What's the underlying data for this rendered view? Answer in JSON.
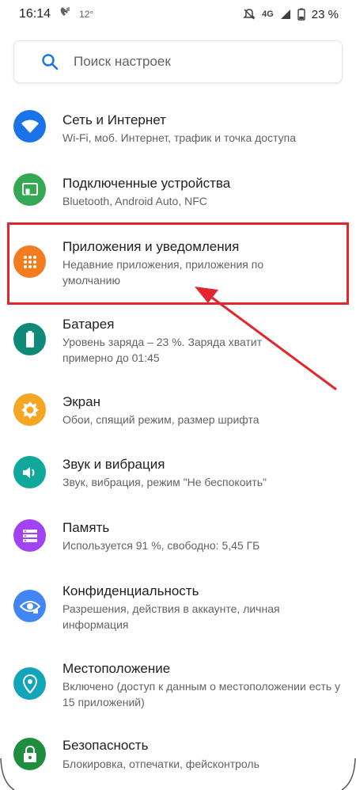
{
  "status": {
    "time": "16:14",
    "temp": "12°",
    "network": "4G",
    "battery": "23 %"
  },
  "search": {
    "placeholder": "Поиск настроек"
  },
  "items": [
    {
      "title": "Сеть и Интернет",
      "sub": "Wi-Fi, моб. Интернет, трафик и точка доступа",
      "color": "#1a73e8",
      "icon": "wifi-icon"
    },
    {
      "title": "Подключенные устройства",
      "sub": "Bluetooth, Android Auto, NFC",
      "color": "#34a853",
      "icon": "devices-icon"
    },
    {
      "title": "Приложения и уведомления",
      "sub": "Недавние приложения, приложения по умолчанию",
      "color": "#f47c20",
      "icon": "apps-icon"
    },
    {
      "title": "Батарея",
      "sub": "Уровень заряда – 23 %. Заряда хватит примерно до 01:45",
      "color": "#0f8a79",
      "icon": "battery-icon"
    },
    {
      "title": "Экран",
      "sub": "Обои, спящий режим, размер шрифта",
      "color": "#f5a623",
      "icon": "brightness-icon"
    },
    {
      "title": "Звук и вибрация",
      "sub": "Звук, вибрация, режим \"Не беспокоить\"",
      "color": "#10a89a",
      "icon": "volume-icon"
    },
    {
      "title": "Память",
      "sub": "Используется 91 %, свободно: 5,45 ГБ",
      "color": "#a142f4",
      "icon": "storage-icon"
    },
    {
      "title": "Конфиденциальность",
      "sub": "Разрешения, действия в аккаунте, личная информация",
      "color": "#4285f4",
      "icon": "privacy-eye-icon"
    },
    {
      "title": "Местоположение",
      "sub": "Включено (доступ к данным о местоположении есть у 15 приложений)",
      "color": "#12a4b8",
      "icon": "location-icon"
    },
    {
      "title": "Безопасность",
      "sub": "Блокировка, отпечатки, фейсконтроль",
      "color": "#1e8e3e",
      "icon": "lock-icon"
    }
  ],
  "colors": {
    "highlight": "#e3262e",
    "accent": "#1a73e8"
  }
}
